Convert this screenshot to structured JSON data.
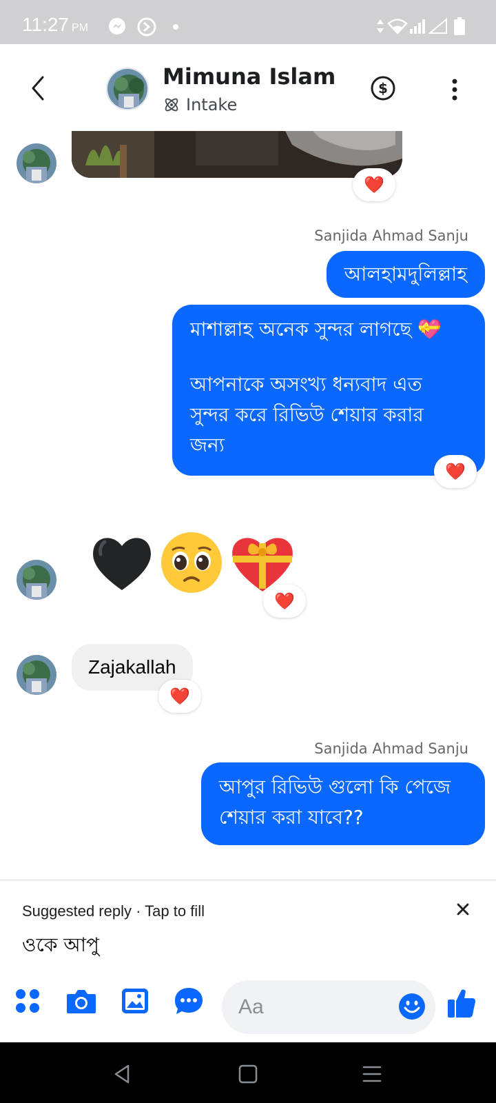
{
  "status_bar": {
    "time": "11:27",
    "ampm": "PM",
    "icons": [
      "messenger-icon",
      "sync-icon",
      "dot-icon",
      "data-arrows-icon",
      "wifi-icon",
      "signal-icon",
      "signal-empty-icon",
      "battery-icon"
    ]
  },
  "header": {
    "contact_name": "Mimuna Islam",
    "subtitle": "Intake",
    "icons": [
      "back-icon",
      "payment-icon",
      "more-icon"
    ]
  },
  "messages": [
    {
      "type": "photo",
      "direction": "in",
      "reaction": "❤️"
    },
    {
      "type": "label",
      "sender": "Sanjida Ahmad Sanju"
    },
    {
      "type": "text",
      "direction": "out",
      "text": "আলহামদুলিল্লাহ"
    },
    {
      "type": "text",
      "direction": "out",
      "line1": "মাশাল্লাহ অনেক সুন্দর লাগছে 💝",
      "line2": "আপনাকে অসংখ্য ধন্যবাদ এত",
      "line3": "সুন্দর করে রিভিউ শেয়ার করার",
      "line4": "জন্য",
      "reaction": "❤️"
    },
    {
      "type": "emoji",
      "direction": "in",
      "emojis": [
        "🖤",
        "🥺",
        "💝"
      ],
      "reaction": "❤️"
    },
    {
      "type": "text",
      "direction": "in",
      "text": "Zajakallah",
      "reaction": "❤️"
    },
    {
      "type": "label",
      "sender": "Sanjida Ahmad Sanju"
    },
    {
      "type": "text",
      "direction": "out",
      "line1": "আপুর রিভিউ গুলো কি পেজে",
      "line2": "শেয়ার করা যাবে??"
    }
  ],
  "suggested_reply": {
    "label": "Suggested reply · Tap to fill",
    "text": "ওকে আপু"
  },
  "composer": {
    "placeholder": "Aa",
    "icons": [
      "apps-icon",
      "camera-icon",
      "gallery-icon",
      "chat-bubble-icon",
      "emoji-icon",
      "like-icon"
    ],
    "accent": "#0a68ff"
  },
  "colors": {
    "outgoing_bubble": "#0a68ff",
    "incoming_bubble": "#f0f0f0",
    "status_bar": "#d0d0d2"
  }
}
